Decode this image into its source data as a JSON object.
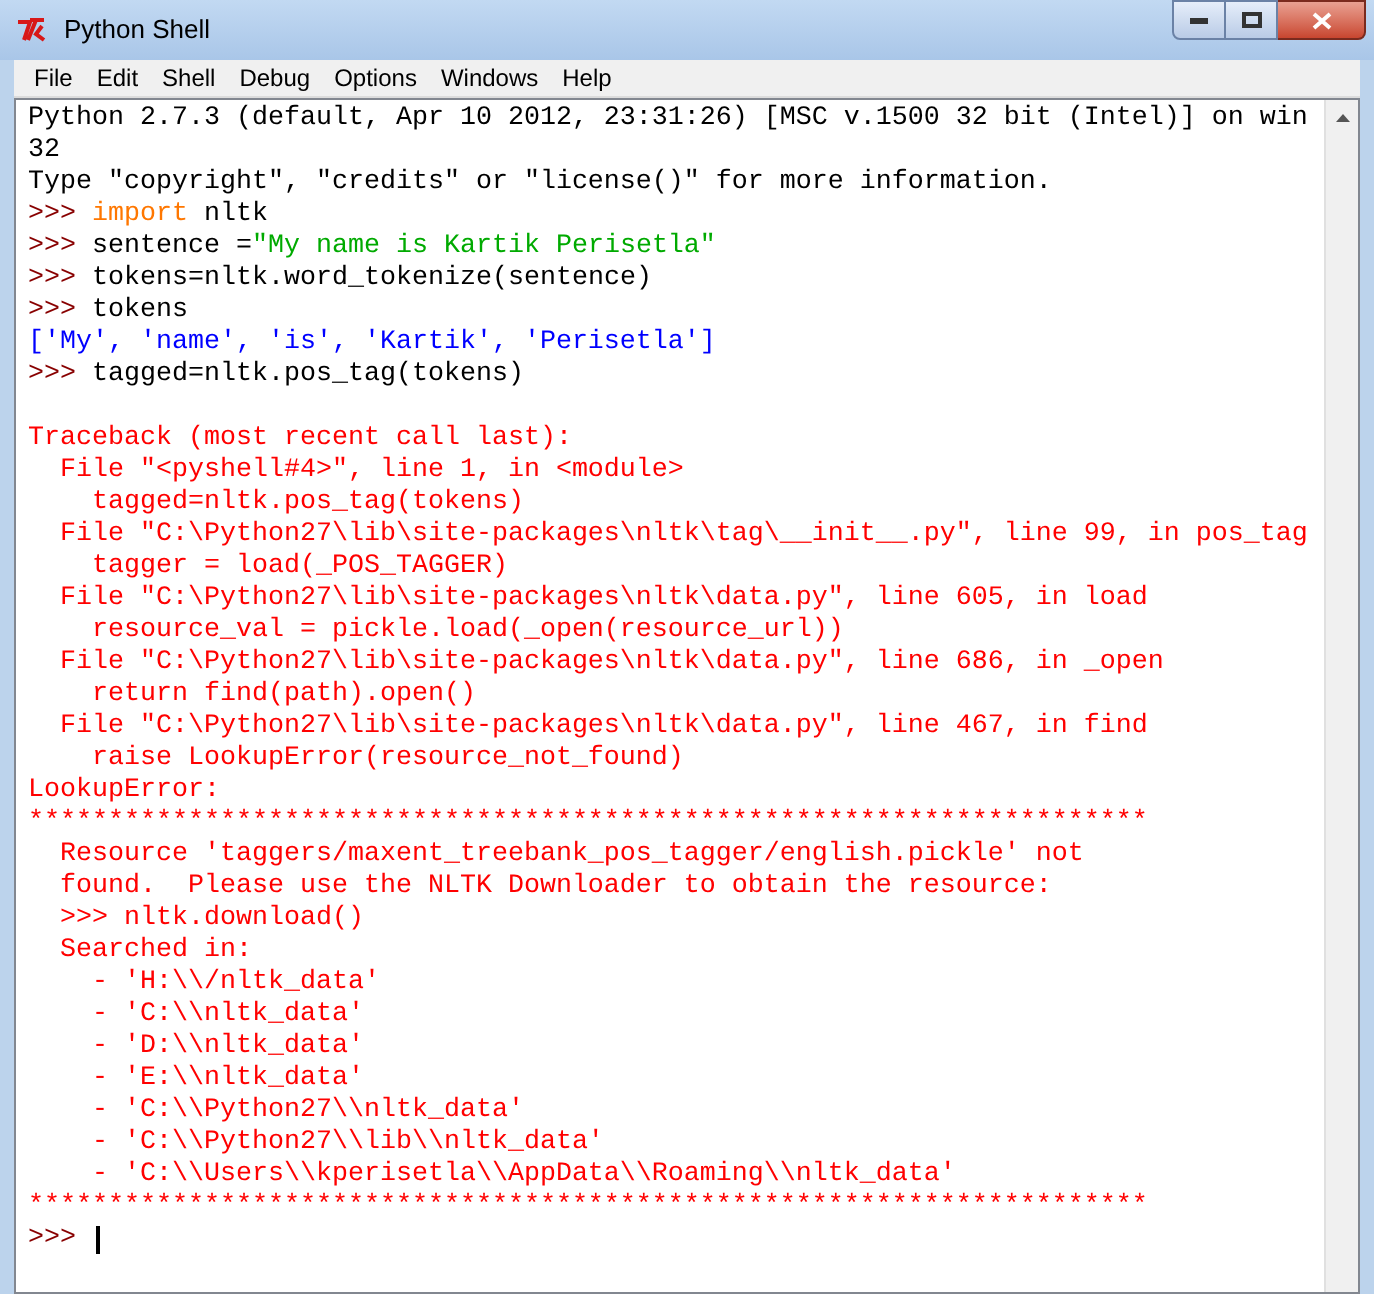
{
  "window": {
    "title": "Python Shell"
  },
  "menu": [
    "File",
    "Edit",
    "Shell",
    "Debug",
    "Options",
    "Windows",
    "Help"
  ],
  "lines": [
    {
      "kind": "text",
      "segments": [
        {
          "kind": "plain",
          "text": "Python 2.7.3 (default, Apr 10 2012, 23:31:26) [MSC v.1500 32 bit (Intel)] on win"
        }
      ]
    },
    {
      "kind": "text",
      "segments": [
        {
          "kind": "plain",
          "text": "32"
        }
      ]
    },
    {
      "kind": "text",
      "segments": [
        {
          "kind": "plain",
          "text": "Type \"copyright\", \"credits\" or \"license()\" for more information."
        }
      ]
    },
    {
      "kind": "text",
      "segments": [
        {
          "kind": "prompt",
          "text": ">>> "
        },
        {
          "kind": "keyword",
          "text": "import"
        },
        {
          "kind": "plain",
          "text": " nltk"
        }
      ]
    },
    {
      "kind": "text",
      "segments": [
        {
          "kind": "prompt",
          "text": ">>> "
        },
        {
          "kind": "plain",
          "text": "sentence ="
        },
        {
          "kind": "string",
          "text": "\"My name is Kartik Perisetla\""
        }
      ]
    },
    {
      "kind": "text",
      "segments": [
        {
          "kind": "prompt",
          "text": ">>> "
        },
        {
          "kind": "plain",
          "text": "tokens=nltk.word_tokenize(sentence)"
        }
      ]
    },
    {
      "kind": "text",
      "segments": [
        {
          "kind": "prompt",
          "text": ">>> "
        },
        {
          "kind": "plain",
          "text": "tokens"
        }
      ]
    },
    {
      "kind": "text",
      "segments": [
        {
          "kind": "output",
          "text": "['My', 'name', 'is', 'Kartik', 'Perisetla']"
        }
      ]
    },
    {
      "kind": "text",
      "segments": [
        {
          "kind": "prompt",
          "text": ">>> "
        },
        {
          "kind": "plain",
          "text": "tagged=nltk.pos_tag(tokens)"
        }
      ]
    },
    {
      "kind": "blank"
    },
    {
      "kind": "text",
      "segments": [
        {
          "kind": "error",
          "text": "Traceback (most recent call last):"
        }
      ]
    },
    {
      "kind": "text",
      "segments": [
        {
          "kind": "error",
          "text": "  File \"<pyshell#4>\", line 1, in <module>"
        }
      ]
    },
    {
      "kind": "text",
      "segments": [
        {
          "kind": "error",
          "text": "    tagged=nltk.pos_tag(tokens)"
        }
      ]
    },
    {
      "kind": "text",
      "segments": [
        {
          "kind": "error",
          "text": "  File \"C:\\Python27\\lib\\site-packages\\nltk\\tag\\__init__.py\", line 99, in pos_tag"
        }
      ]
    },
    {
      "kind": "text",
      "segments": [
        {
          "kind": "error",
          "text": "    tagger = load(_POS_TAGGER)"
        }
      ]
    },
    {
      "kind": "text",
      "segments": [
        {
          "kind": "error",
          "text": "  File \"C:\\Python27\\lib\\site-packages\\nltk\\data.py\", line 605, in load"
        }
      ]
    },
    {
      "kind": "text",
      "segments": [
        {
          "kind": "error",
          "text": "    resource_val = pickle.load(_open(resource_url))"
        }
      ]
    },
    {
      "kind": "text",
      "segments": [
        {
          "kind": "error",
          "text": "  File \"C:\\Python27\\lib\\site-packages\\nltk\\data.py\", line 686, in _open"
        }
      ]
    },
    {
      "kind": "text",
      "segments": [
        {
          "kind": "error",
          "text": "    return find(path).open()"
        }
      ]
    },
    {
      "kind": "text",
      "segments": [
        {
          "kind": "error",
          "text": "  File \"C:\\Python27\\lib\\site-packages\\nltk\\data.py\", line 467, in find"
        }
      ]
    },
    {
      "kind": "text",
      "segments": [
        {
          "kind": "error",
          "text": "    raise LookupError(resource_not_found)"
        }
      ]
    },
    {
      "kind": "text",
      "segments": [
        {
          "kind": "error",
          "text": "LookupError: "
        }
      ]
    },
    {
      "kind": "text",
      "segments": [
        {
          "kind": "error",
          "text": "**********************************************************************"
        }
      ]
    },
    {
      "kind": "text",
      "segments": [
        {
          "kind": "error",
          "text": "  Resource 'taggers/maxent_treebank_pos_tagger/english.pickle' not"
        }
      ]
    },
    {
      "kind": "text",
      "segments": [
        {
          "kind": "error",
          "text": "  found.  Please use the NLTK Downloader to obtain the resource:"
        }
      ]
    },
    {
      "kind": "text",
      "segments": [
        {
          "kind": "error",
          "text": "  >>> nltk.download()"
        }
      ]
    },
    {
      "kind": "text",
      "segments": [
        {
          "kind": "error",
          "text": "  Searched in:"
        }
      ]
    },
    {
      "kind": "text",
      "segments": [
        {
          "kind": "error",
          "text": "    - 'H:\\\\/nltk_data'"
        }
      ]
    },
    {
      "kind": "text",
      "segments": [
        {
          "kind": "error",
          "text": "    - 'C:\\\\nltk_data'"
        }
      ]
    },
    {
      "kind": "text",
      "segments": [
        {
          "kind": "error",
          "text": "    - 'D:\\\\nltk_data'"
        }
      ]
    },
    {
      "kind": "text",
      "segments": [
        {
          "kind": "error",
          "text": "    - 'E:\\\\nltk_data'"
        }
      ]
    },
    {
      "kind": "text",
      "segments": [
        {
          "kind": "error",
          "text": "    - 'C:\\\\Python27\\\\nltk_data'"
        }
      ]
    },
    {
      "kind": "text",
      "segments": [
        {
          "kind": "error",
          "text": "    - 'C:\\\\Python27\\\\lib\\\\nltk_data'"
        }
      ]
    },
    {
      "kind": "text",
      "segments": [
        {
          "kind": "error",
          "text": "    - 'C:\\\\Users\\\\kperisetla\\\\AppData\\\\Roaming\\\\nltk_data'"
        }
      ]
    },
    {
      "kind": "text",
      "segments": [
        {
          "kind": "error",
          "text": "**********************************************************************"
        }
      ]
    },
    {
      "kind": "input",
      "segments": [
        {
          "kind": "prompt",
          "text": ">>> "
        }
      ]
    }
  ]
}
